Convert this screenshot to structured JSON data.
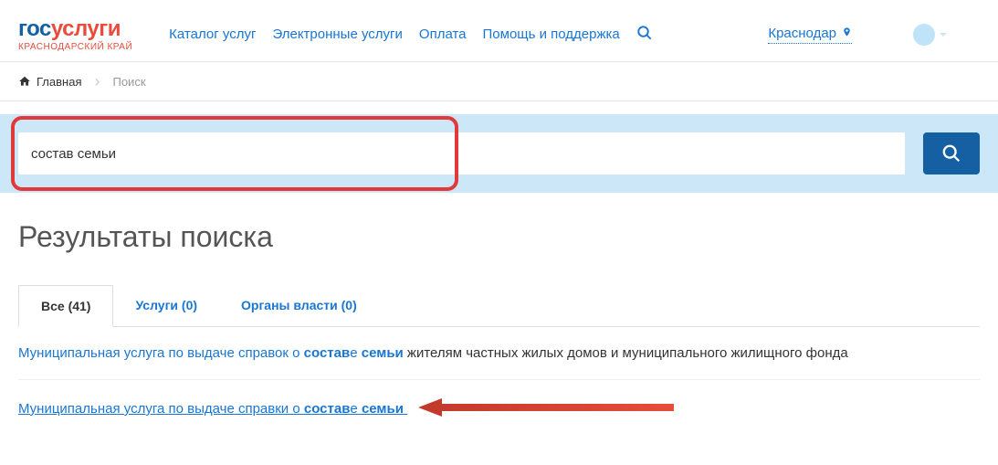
{
  "logo": {
    "p1": "гос",
    "p2": "услуги",
    "sub": "КРАСНОДАРСКИЙ КРАЙ"
  },
  "nav": {
    "catalog": "Каталог услуг",
    "eservices": "Электронные услуги",
    "payment": "Оплата",
    "help": "Помощь и поддержка"
  },
  "region": "Краснодар",
  "breadcrumb": {
    "home": "Главная",
    "current": "Поиск"
  },
  "search": {
    "query": "состав семьи"
  },
  "results": {
    "title": "Результаты поиска",
    "tabs": {
      "all": "Все (41)",
      "services": "Услуги (0)",
      "authorities": "Органы власти (0)"
    },
    "items": [
      {
        "pre": "Муниципальная услуга по выдаче справок о ",
        "hl1": "состав",
        "mid": "е ",
        "hl2": "семьи",
        "post": " жителям частных жилых домов и муниципального жилищного фонда",
        "underline": false
      },
      {
        "pre": "Муниципальная услуга по выдаче справки о ",
        "hl1": "состав",
        "mid": "е ",
        "hl2": "семьи",
        "post": "",
        "underline": true
      }
    ]
  }
}
